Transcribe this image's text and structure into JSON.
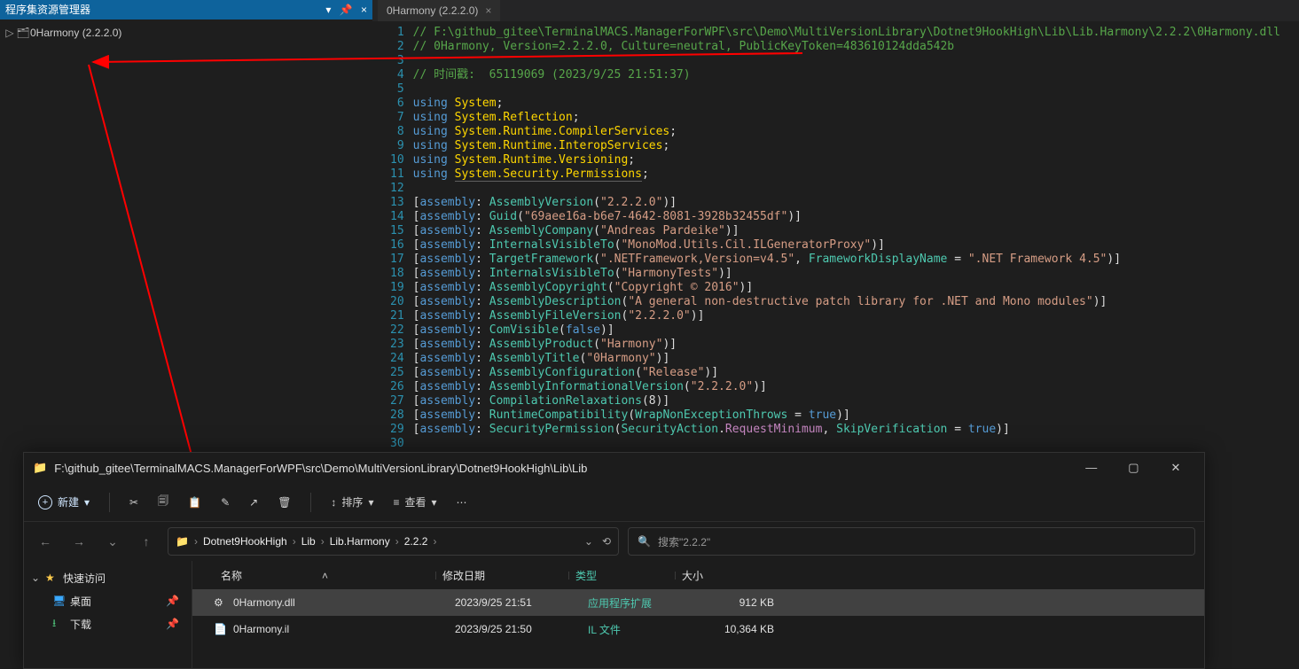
{
  "vs": {
    "panelTitle": "程序集资源管理器",
    "treeItem": "0Harmony (2.2.2.0)",
    "tabTitle": "0Harmony (2.2.2.0)",
    "code": {
      "lines": [
        {
          "n": 1,
          "type": "comment",
          "text": "// F:\\github_gitee\\TerminalMACS.ManagerForWPF\\src\\Demo\\MultiVersionLibrary\\Dotnet9HookHigh\\Lib\\Lib.Harmony\\2.2.2\\0Harmony.dll"
        },
        {
          "n": 2,
          "type": "comment",
          "text": "// 0Harmony, Version=2.2.2.0, Culture=neutral, PublicKeyToken=483610124dda542b"
        },
        {
          "n": 3,
          "type": "blank"
        },
        {
          "n": 4,
          "type": "comment",
          "text": "// 时间戳:  65119069 (2023/9/25 21:51:37)"
        },
        {
          "n": 5,
          "type": "blank"
        },
        {
          "n": 6,
          "type": "using",
          "ns": "System"
        },
        {
          "n": 7,
          "type": "using",
          "ns": "System.Reflection"
        },
        {
          "n": 8,
          "type": "using",
          "ns": "System.Runtime.CompilerServices"
        },
        {
          "n": 9,
          "type": "using",
          "ns": "System.Runtime.InteropServices"
        },
        {
          "n": 10,
          "type": "using",
          "ns": "System.Runtime.Versioning"
        },
        {
          "n": 11,
          "type": "using",
          "ns": "System.Security.Permissions",
          "underline": true
        },
        {
          "n": 12,
          "type": "blank"
        },
        {
          "n": 13,
          "type": "attr",
          "name": "AssemblyVersion",
          "args": [
            {
              "t": "str",
              "v": "\"2.2.2.0\""
            }
          ]
        },
        {
          "n": 14,
          "type": "attr",
          "name": "Guid",
          "args": [
            {
              "t": "str",
              "v": "\"69aee16a-b6e7-4642-8081-3928b32455df\""
            }
          ]
        },
        {
          "n": 15,
          "type": "attr",
          "name": "AssemblyCompany",
          "args": [
            {
              "t": "str",
              "v": "\"Andreas Pardeike\""
            }
          ]
        },
        {
          "n": 16,
          "type": "attr",
          "name": "InternalsVisibleTo",
          "args": [
            {
              "t": "str",
              "v": "\"MonoMod.Utils.Cil.ILGeneratorProxy\""
            }
          ]
        },
        {
          "n": 17,
          "type": "attr",
          "name": "TargetFramework",
          "args": [
            {
              "t": "str",
              "v": "\".NETFramework,Version=v4.5\""
            },
            {
              "t": "named",
              "k": "FrameworkDisplayName",
              "v": "\".NET Framework 4.5\""
            }
          ]
        },
        {
          "n": 18,
          "type": "attr",
          "name": "InternalsVisibleTo",
          "args": [
            {
              "t": "str",
              "v": "\"HarmonyTests\""
            }
          ]
        },
        {
          "n": 19,
          "type": "attr",
          "name": "AssemblyCopyright",
          "args": [
            {
              "t": "str",
              "v": "\"Copyright © 2016\""
            }
          ]
        },
        {
          "n": 20,
          "type": "attr",
          "name": "AssemblyDescription",
          "args": [
            {
              "t": "str",
              "v": "\"A general non-destructive patch library for .NET and Mono modules\""
            }
          ]
        },
        {
          "n": 21,
          "type": "attr",
          "name": "AssemblyFileVersion",
          "args": [
            {
              "t": "str",
              "v": "\"2.2.2.0\""
            }
          ]
        },
        {
          "n": 22,
          "type": "attr",
          "name": "ComVisible",
          "args": [
            {
              "t": "bool",
              "v": "false"
            }
          ]
        },
        {
          "n": 23,
          "type": "attr",
          "name": "AssemblyProduct",
          "args": [
            {
              "t": "str",
              "v": "\"Harmony\""
            }
          ]
        },
        {
          "n": 24,
          "type": "attr",
          "name": "AssemblyTitle",
          "args": [
            {
              "t": "str",
              "v": "\"0Harmony\""
            }
          ]
        },
        {
          "n": 25,
          "type": "attr",
          "name": "AssemblyConfiguration",
          "args": [
            {
              "t": "str",
              "v": "\"Release\""
            }
          ]
        },
        {
          "n": 26,
          "type": "attr",
          "name": "AssemblyInformationalVersion",
          "args": [
            {
              "t": "str",
              "v": "\"2.2.2.0\""
            }
          ]
        },
        {
          "n": 27,
          "type": "attr",
          "name": "CompilationRelaxations",
          "args": [
            {
              "t": "num",
              "v": "8"
            }
          ]
        },
        {
          "n": 28,
          "type": "attr",
          "name": "RuntimeCompatibility",
          "args": [
            {
              "t": "named",
              "k": "WrapNonExceptionThrows",
              "vb": "true"
            }
          ]
        },
        {
          "n": 29,
          "type": "attr",
          "name": "SecurityPermission",
          "args": [
            {
              "t": "enum",
              "cls": "SecurityAction",
              "m": "RequestMinimum"
            },
            {
              "t": "named",
              "k": "SkipVerification",
              "vb": "true"
            }
          ]
        },
        {
          "n": 30,
          "type": "blank"
        }
      ]
    }
  },
  "fx": {
    "titlePath": "F:\\github_gitee\\TerminalMACS.ManagerForWPF\\src\\Demo\\MultiVersionLibrary\\Dotnet9HookHigh\\Lib\\Lib",
    "toolbar": {
      "new": "新建",
      "sort": "排序",
      "view": "查看"
    },
    "crumbs": [
      "Dotnet9HookHigh",
      "Lib",
      "Lib.Harmony",
      "2.2.2"
    ],
    "searchPlaceholder": "搜索\"2.2.2\"",
    "side": {
      "quick": "快速访问",
      "desktop": "桌面",
      "downloads": "下载"
    },
    "cols": {
      "name": "名称",
      "date": "修改日期",
      "type": "类型",
      "size": "大小"
    },
    "rows": [
      {
        "icon": "⚙",
        "name": "0Harmony.dll",
        "date": "2023/9/25 21:51",
        "type": "应用程序扩展",
        "size": "912 KB",
        "selected": true
      },
      {
        "icon": "📄",
        "name": "0Harmony.il",
        "date": "2023/9/25 21:50",
        "type": "IL 文件",
        "size": "10,364 KB",
        "selected": false
      }
    ]
  }
}
